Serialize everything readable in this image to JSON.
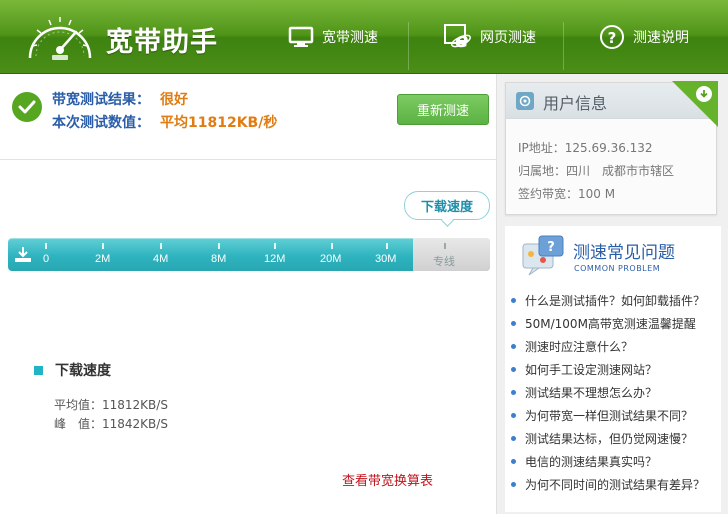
{
  "app": {
    "title": "宽带助手"
  },
  "nav": [
    {
      "label": "宽带测速",
      "icon": "monitor-icon"
    },
    {
      "label": "网页测速",
      "icon": "ie-browser-icon"
    },
    {
      "label": "测速说明",
      "icon": "help-icon"
    }
  ],
  "result": {
    "label1": "带宽测试结果：",
    "value1": "很好",
    "label2": "本次测试数值：",
    "value2": "平均11812KB/秒",
    "retest_button": "重新测速"
  },
  "speed_meter": {
    "bubble": "下载速度",
    "ticks": [
      "0",
      "2M",
      "4M",
      "8M",
      "12M",
      "20M",
      "30M",
      "专线"
    ]
  },
  "stats": {
    "title": "下载速度",
    "avg": "平均值：11812KB/S",
    "peak": "峰　值：11842KB/S"
  },
  "bandwidth_link": "查看带宽换算表",
  "user_info": {
    "title": "用户信息",
    "ip": "IP地址：125.69.36.132",
    "location": "归属地：四川　成都市市辖区",
    "bandwidth": "签约带宽：100 M"
  },
  "faq": {
    "title": "测速常见问题",
    "subtitle": "COMMON PROBLEM",
    "items": [
      "什么是测试插件？如何卸载插件？",
      "50M/100M高带宽测速温馨提醒",
      "测速时应注意什么？",
      "如何手工设定测速网站？",
      "测试结果不理想怎么办？",
      "为何带宽一样但测试结果不同？",
      "测试结果达标，但仍觉网速慢？",
      "电信的测速结果真实吗？",
      "为何不同时间的测试结果有差异？"
    ]
  },
  "colors": {
    "header_green": "#4f9418",
    "accent_orange": "#e07c12",
    "label_blue": "#2b5ea8",
    "meter_teal": "#2eb4bf",
    "link_red": "#c0141c"
  }
}
